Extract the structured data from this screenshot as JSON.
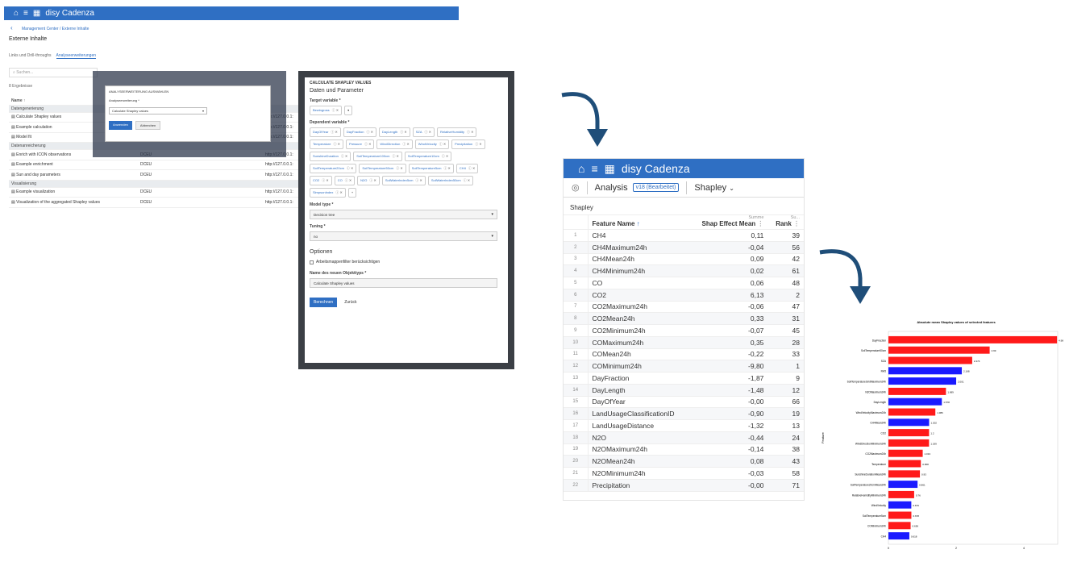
{
  "mc": {
    "app_title": "disy Cadenza",
    "breadcrumb": "Management Center / Externe Inhalte",
    "page_title": "Externe Inhalte",
    "tabs": [
      "Links und Drill-throughs",
      "Analyseerweiterungen"
    ],
    "search_placeholder": "Suchen...",
    "result_count": "8 Ergebnisse",
    "col_name": "Name ↑",
    "rows": [
      {
        "type": "group",
        "name": "Datengenerierung"
      },
      {
        "type": "row",
        "name": "Calculate Shapley values",
        "owner": "",
        "url": "http://127.0.0.1:"
      },
      {
        "type": "row",
        "name": "Example calculation",
        "owner": "",
        "url": "http://127.0.0.1:"
      },
      {
        "type": "row",
        "name": "Model fit",
        "owner": "",
        "url": "http://127.0.0.1:"
      },
      {
        "type": "group",
        "name": "Datenanreicherung"
      },
      {
        "type": "row",
        "name": "Enrich with ICON observations",
        "owner": "DCEU",
        "url": "http://127.0.0.1:"
      },
      {
        "type": "row",
        "name": "Example enrichment",
        "owner": "DCEU",
        "url": "http://127.0.0.1:"
      },
      {
        "type": "row",
        "name": "Sun and day parameters",
        "owner": "DCEU",
        "url": "http://127.0.0.1:"
      },
      {
        "type": "group",
        "name": "Visualisierung"
      },
      {
        "type": "row",
        "name": "Example visualization",
        "owner": "DCEU",
        "url": "http://127.0.0.1:"
      },
      {
        "type": "row",
        "name": "Visualization of the aggregated Shapley values",
        "owner": "DCEU",
        "url": "http://127.0.0.1:"
      }
    ],
    "dialog": {
      "title": "ANALYSEERWEITERUNG AUSWÄHLEN",
      "field_label": "Analyseerweiterung *",
      "selected": "Calculate Shapley values",
      "apply": "Anwenden",
      "cancel": "Abbrechen"
    }
  },
  "shapley_dialog": {
    "header": "CALCULATE SHAPLEY VALUES",
    "section": "Daten und Parameter",
    "target_label": "Target variable *",
    "target_value": "Bewingross",
    "dependent_label": "Dependent variable *",
    "dependent_chips": [
      "DayOfYear",
      "DayFraction",
      "DayLength",
      "SZA",
      "RelativeHumidity",
      "Temperature",
      "Pressure",
      "WindDirection",
      "WindVelocity",
      "Precipitation",
      "SunshineDuration",
      "SoilTemperature100cm",
      "SoilTemperature10cm",
      "SoilTemperature20cm",
      "SoilTemperature50cm",
      "SoilTemperature5cm",
      "CH4",
      "CO2",
      "CO",
      "N2O",
      "SoilWaterIndex5cm",
      "SoilWaterIndex50cm",
      "SimpsonIndex"
    ],
    "model_type_label": "Model type *",
    "model_type_value": "Decision tree",
    "tuning_label": "Tuning *",
    "tuning_value": "no",
    "options_label": "Optionen",
    "checkbox_label": "Arbeitsmappenfilter berücksichtigen",
    "name_label": "Name des neuen Objekttyps *",
    "name_value": "Calculate Shapley values",
    "calc": "Berechnen",
    "back": "Zurück"
  },
  "analysis": {
    "app_title": "disy Cadenza",
    "toolbar_label": "Analysis",
    "version": "v18 (Bearbeitet)",
    "view": "Shapley",
    "section": "Shapley",
    "col_feature": "Feature Name",
    "col_mean_top": "Summe",
    "col_mean": "Shap Effect Mean",
    "col_rank_top": "Su...",
    "col_rank": "Rank",
    "rows": [
      [
        "1",
        "CH4",
        "0,11",
        "39"
      ],
      [
        "2",
        "CH4Maximum24h",
        "-0,04",
        "56"
      ],
      [
        "3",
        "CH4Mean24h",
        "0,09",
        "42"
      ],
      [
        "4",
        "CH4Minimum24h",
        "0,02",
        "61"
      ],
      [
        "5",
        "CO",
        "0,06",
        "48"
      ],
      [
        "6",
        "CO2",
        "6,13",
        "2"
      ],
      [
        "7",
        "CO2Maximum24h",
        "-0,06",
        "47"
      ],
      [
        "8",
        "CO2Mean24h",
        "0,33",
        "31"
      ],
      [
        "9",
        "CO2Minimum24h",
        "-0,07",
        "45"
      ],
      [
        "10",
        "COMaximum24h",
        "0,35",
        "28"
      ],
      [
        "11",
        "COMean24h",
        "-0,22",
        "33"
      ],
      [
        "12",
        "COMinimum24h",
        "-9,80",
        "1"
      ],
      [
        "13",
        "DayFraction",
        "-1,87",
        "9"
      ],
      [
        "14",
        "DayLength",
        "-1,48",
        "12"
      ],
      [
        "15",
        "DayOfYear",
        "-0,00",
        "66"
      ],
      [
        "16",
        "LandUsageClassificationID",
        "-0,90",
        "19"
      ],
      [
        "17",
        "LandUsageDistance",
        "-1,32",
        "13"
      ],
      [
        "18",
        "N2O",
        "-0,44",
        "24"
      ],
      [
        "19",
        "N2OMaximum24h",
        "-0,14",
        "38"
      ],
      [
        "20",
        "N2OMean24h",
        "0,08",
        "43"
      ],
      [
        "21",
        "N2OMinimum24h",
        "-0,03",
        "58"
      ],
      [
        "22",
        "Precipitation",
        "-0,00",
        "71"
      ]
    ]
  },
  "chart_data": {
    "type": "bar",
    "orientation": "horizontal",
    "title": "Absolute mean Shapley values of selected features",
    "ylabel": "Feature",
    "colors": {
      "positive": "#ff1a1a",
      "negative": "#1a1aff"
    },
    "categories": [
      "DayFraction",
      "SoilTemperature50cm",
      "SZA",
      "RH5",
      "SoilTemperatureGridMaximum24h",
      "N2OMaximum24h",
      "DayLength",
      "WindVelocityMaximum24h",
      "CH4Mean24h",
      "CO2",
      "WindDirectionMinimum24h",
      "CO2Maximum24h",
      "Temperature",
      "SunshineDurationMean24h",
      "SoilTemperature20cmMean24h",
      "RelativeHumidityMinimum24h",
      "WindVelocity",
      "SoilTemperature5cm",
      "COMinimum24h",
      "CH4"
    ],
    "values": [
      4.98,
      2.99,
      2.474,
      2.168,
      2.001,
      1.699,
      1.578,
      1.386,
      1.202,
      1.2,
      1.199,
      1.013,
      0.958,
      0.93,
      0.861,
      0.76,
      0.676,
      0.678,
      0.656,
      0.618
    ],
    "signs": [
      "pos",
      "pos",
      "pos",
      "neg",
      "neg",
      "pos",
      "neg",
      "pos",
      "neg",
      "pos",
      "pos",
      "pos",
      "pos",
      "pos",
      "neg",
      "pos",
      "neg",
      "pos",
      "pos",
      "neg"
    ],
    "value_labels": [
      "4.98",
      "2.99",
      "2.474",
      "2.168",
      "2.001",
      "1.699",
      "1.578",
      "1.386",
      "1.202",
      "1.2",
      "1.199",
      "1.013",
      "0.958",
      "0.93",
      "0.861",
      "0.76",
      "0.676",
      "0.678",
      "0.656",
      "0.618"
    ],
    "xlim": [
      0,
      5
    ],
    "xticks": [
      "0",
      "2",
      "4"
    ]
  }
}
